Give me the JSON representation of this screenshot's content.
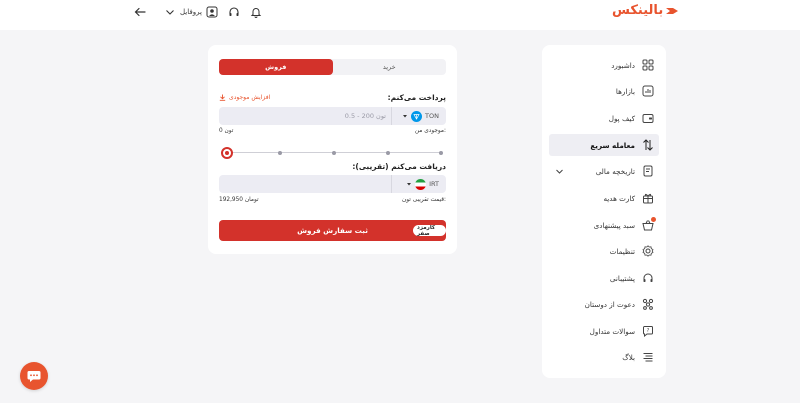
{
  "brand": {
    "name": "بالینکس",
    "color": "#e8542e"
  },
  "header": {
    "profile_label": "پروفایل",
    "icons": [
      "back-arrow-icon",
      "chevron-down-icon",
      "user-icon",
      "headset-icon",
      "bell-icon"
    ]
  },
  "sidebar": {
    "items": [
      {
        "label": "داشبورد",
        "icon": "dashboard-icon"
      },
      {
        "label": "بازارها",
        "icon": "markets-icon"
      },
      {
        "label": "کیف پول",
        "icon": "wallet-icon"
      },
      {
        "label": "معامله سریع",
        "icon": "swap-icon",
        "active": true
      },
      {
        "label": "تاریخچه مالی",
        "icon": "history-icon",
        "expandable": true
      },
      {
        "label": "کارت هدیه",
        "icon": "gift-icon"
      },
      {
        "label": "سبد پیشنهادی",
        "icon": "basket-icon",
        "badge": true
      },
      {
        "label": "تنظیمات",
        "icon": "settings-icon"
      },
      {
        "label": "پشتیبانی",
        "icon": "support-icon"
      },
      {
        "label": "دعوت از دوستان",
        "icon": "invite-icon"
      },
      {
        "label": "سوالات متداول",
        "icon": "faq-icon"
      },
      {
        "label": "بلاگ",
        "icon": "blog-icon"
      }
    ]
  },
  "trade": {
    "tabs": {
      "buy": "خرید",
      "sell": "فروش",
      "active": "sell"
    },
    "pay": {
      "title": "پرداخت می‌کنم:",
      "increase_balance": "افزایش موجودی",
      "coin": "TON",
      "placeholder": "0.5 - 200 تون",
      "balance_label": "موجودی من:",
      "balance_value": "0 تون"
    },
    "slider": {
      "value_percent": 0,
      "steps": 5
    },
    "receive": {
      "title": "دریافت می‌کنم (تقریبی):",
      "coin": "IRT",
      "price_label": "قیمت تقریبی تون:",
      "price_value": "192,950 تومان"
    },
    "submit_label": "ثبت سفارش فروش",
    "fee_badge": "کارمزد صفر"
  },
  "colors": {
    "accent": "#d3322b",
    "brand": "#e8542e",
    "ton": "#0098ea"
  }
}
